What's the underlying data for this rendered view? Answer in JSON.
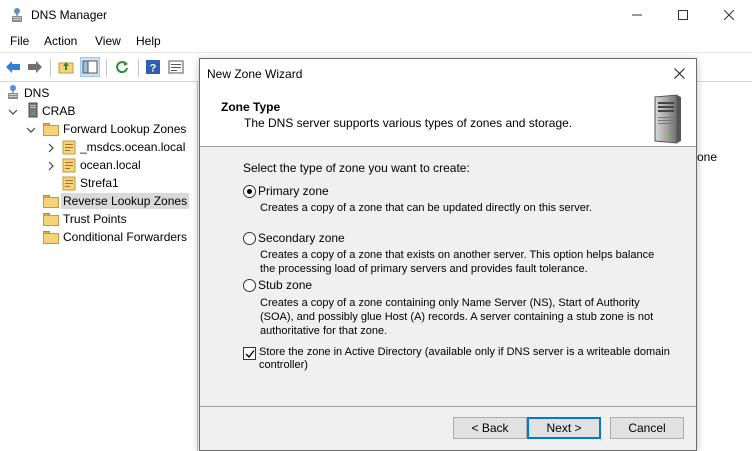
{
  "window": {
    "title": "DNS Manager"
  },
  "menu": {
    "items": [
      "File",
      "Action",
      "View",
      "Help"
    ]
  },
  "tree": {
    "root": "DNS",
    "server": "CRAB",
    "forward": "Forward Lookup Zones",
    "zones": [
      "_msdcs.ocean.local",
      "ocean.local",
      "Strefa1"
    ],
    "reverse": "Reverse Lookup Zones",
    "trust": "Trust Points",
    "conditional": "Conditional Forwarders"
  },
  "right_pane": {
    "partial_text": "one"
  },
  "dialog": {
    "title": "New Zone Wizard",
    "header_title": "Zone Type",
    "header_subtitle": "The DNS server supports various types of zones and storage.",
    "prompt": "Select the type of zone you want to create:",
    "options": [
      {
        "label": "Primary zone",
        "description": "Creates a copy of a zone that can be updated directly on this server.",
        "checked": true
      },
      {
        "label": "Secondary zone",
        "description": "Creates a copy of a zone that exists on another server. This option helps balance the processing load of primary servers and provides fault tolerance.",
        "checked": false
      },
      {
        "label": "Stub zone",
        "description": "Creates a copy of a zone containing only Name Server (NS), Start of Authority (SOA), and possibly glue Host (A) records. A server containing a stub zone is not authoritative for that zone.",
        "checked": false
      }
    ],
    "store_ad": {
      "label": "Store the zone in Active Directory (available only if DNS server is a writeable domain controller)",
      "checked": true
    },
    "buttons": {
      "back": "< Back",
      "next": "Next >",
      "cancel": "Cancel"
    }
  }
}
